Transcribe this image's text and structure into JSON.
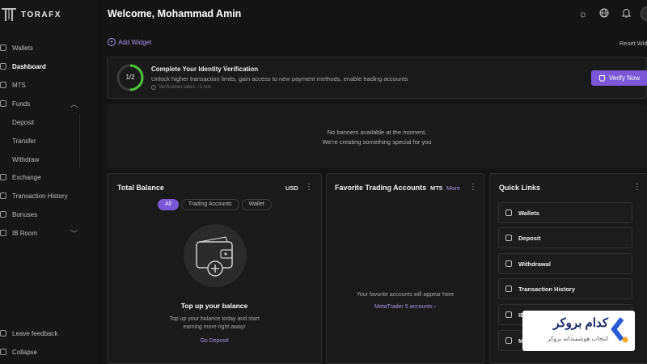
{
  "brand": {
    "name": "TORAFX"
  },
  "sidebar": {
    "items": [
      {
        "label": "Wallets",
        "icon": "wallet-icon"
      },
      {
        "label": "Dashboard",
        "icon": "dashboard-icon",
        "active": true
      },
      {
        "label": "MTS",
        "icon": "chart-icon"
      },
      {
        "label": "Funds",
        "icon": "funds-icon",
        "expanded": true
      },
      {
        "label": "Deposit"
      },
      {
        "label": "Transfer"
      },
      {
        "label": "Withdraw"
      },
      {
        "label": "Exchange",
        "icon": "exchange-icon"
      },
      {
        "label": "Transaction History",
        "icon": "history-icon"
      },
      {
        "label": "Bonuses",
        "icon": "gift-icon"
      },
      {
        "label": "IB Room",
        "icon": "ib-icon"
      }
    ],
    "footer": [
      {
        "label": "Leave feedback",
        "icon": "feedback-icon"
      },
      {
        "label": "Collapse",
        "icon": "collapse-icon"
      }
    ]
  },
  "header": {
    "welcome": "Welcome, Mohammad Amin",
    "icons": [
      "theme-icon",
      "globe-icon",
      "bell-icon",
      "avatar"
    ]
  },
  "toolbar": {
    "add_widget": "Add Widget",
    "reset": "Reset Widg"
  },
  "verification": {
    "progress": "1/2",
    "progress_fraction": 0.5,
    "title": "Complete Your Identity Verification",
    "description": "Unlock higher transaction limits, gain access to new payment methods, enable trading accounts",
    "note": "Verification takes ~1 min",
    "button": "Verify Now"
  },
  "banner": {
    "line1": "No banners available at the moment.",
    "line2": "We're creating something special for you"
  },
  "balance": {
    "title": "Total Balance",
    "currency": "USD",
    "tabs": [
      "All",
      "Trading Accounts",
      "Wallet"
    ],
    "active_tab": "All",
    "empty_title": "Top up your balance",
    "empty_desc_1": "Top up your balance today and start",
    "empty_desc_2": "earning more right away!",
    "cta": "Go Deposit"
  },
  "favorites": {
    "title": "Favorite Trading Accounts",
    "platform": "MT5",
    "more": "More",
    "empty": "Your favorite accounts will appear here",
    "link": "MetaTrader 5 accounts ›"
  },
  "quick_links": {
    "title": "Quick Links",
    "items": [
      {
        "label": "Wallets",
        "icon": "wallet-icon"
      },
      {
        "label": "Deposit",
        "icon": "deposit-icon"
      },
      {
        "label": "Withdrawal",
        "icon": "withdraw-icon"
      },
      {
        "label": "Transaction History",
        "icon": "history-icon"
      },
      {
        "label": "IB",
        "icon": "ib-icon"
      },
      {
        "label": "M",
        "icon": "gift-icon"
      }
    ]
  },
  "watermark": {
    "line1": "کدام بروکر",
    "line2": "انتخاب هوشمندانه بروکر"
  },
  "colors": {
    "accent": "#7b58d8",
    "ring": "#4cc23a",
    "background": "#141414"
  }
}
